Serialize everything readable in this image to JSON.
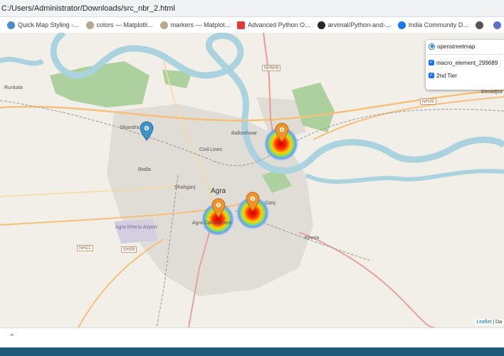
{
  "browser": {
    "address": "C:/Users/Administrator/Downloads/src_nbr_2.html",
    "bookmarks": [
      {
        "label": "Quick Map Styling -...",
        "icon": "map-styling-icon",
        "color": "#4a8bd6"
      },
      {
        "label": "colors — Matplotli...",
        "icon": "matplotlib-icon",
        "color": "#b8a98a"
      },
      {
        "label": "markers — Matplot...",
        "icon": "matplotlib-icon",
        "color": "#b8a98a"
      },
      {
        "label": "Advanced Python O...",
        "icon": "youtube-icon",
        "color": "#e53935"
      },
      {
        "label": "arvimal/Python-and-...",
        "icon": "github-icon",
        "color": "#24292e"
      },
      {
        "label": "India Community D...",
        "icon": "facebook-icon",
        "color": "#1877f2"
      }
    ]
  },
  "map": {
    "labels": {
      "runkata": "Runkata",
      "sikandra": "Sikandra",
      "balkeshwar": "Balkeshwar",
      "civil_lines": "Civil Lines",
      "bodla": "Bodla",
      "shahganj": "Shahganj",
      "agra": "Agra",
      "agra_cantonment": "Agra Cantonment",
      "ganj": "Ganj",
      "agra_airport": "Agra Kheria Airport",
      "kheria": "Kheria",
      "etmadpur": "Etmadpur",
      "nh509": "NH509",
      "nh19": "NH19",
      "nh21": "NH21",
      "sh39": "SH39"
    },
    "colors": {
      "water": "#aad3df",
      "park": "#add19e",
      "road": "#f6c07a",
      "urban": "#e0dcd6"
    }
  },
  "layer_control": {
    "base": "openstreetmap",
    "overlays": [
      "macro_element_299689",
      "2nd Tier"
    ]
  },
  "attribution": {
    "leaflet": "Leaflet",
    "rest": " | Da"
  }
}
